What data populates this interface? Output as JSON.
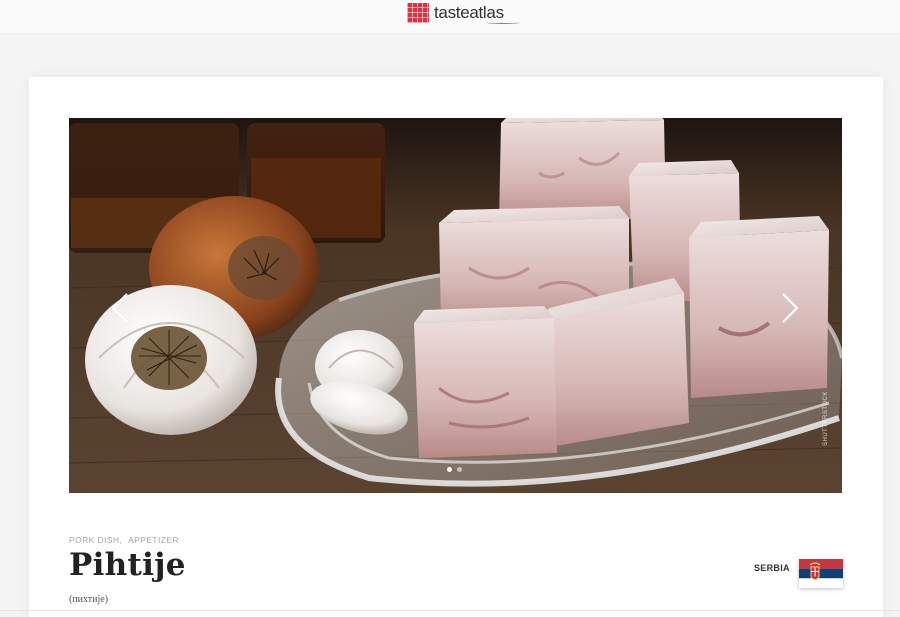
{
  "header": {
    "logo_text_left": "taste",
    "logo_text_right": "atlas",
    "logo_icon": "checkered-tablecloth-icon",
    "logo_color": "#d8343d"
  },
  "gallery": {
    "image_alt": "Pihtije on a glass plate with garlic and onion",
    "credit": "SHUTTERSTOCK",
    "slide_count": 2,
    "active_slide": 1,
    "prev_icon": "chevron-left-icon",
    "next_icon": "chevron-right-icon"
  },
  "dish": {
    "categories": [
      "PORK DISH,",
      "APPETIZER"
    ],
    "name": "Pihtije",
    "native_name": "(пихтије)",
    "country": "SERBIA",
    "flag_colors": [
      "#c6363c",
      "#0c4076",
      "#ffffff"
    ]
  }
}
